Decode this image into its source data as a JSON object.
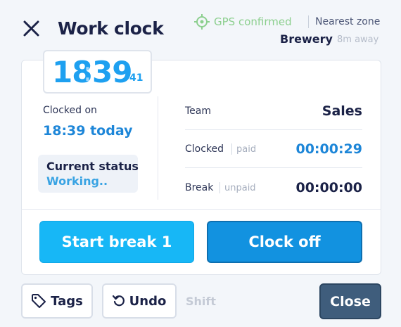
{
  "header": {
    "title": "Work clock",
    "gps_status": "GPS confirmed",
    "nearest_zone_label": "Nearest zone",
    "zone_name": "Brewery",
    "zone_distance": "8m away"
  },
  "clock": {
    "hours": "18",
    "separator": ":",
    "minutes": "39",
    "seconds": "41"
  },
  "clocked_on": {
    "label": "Clocked on",
    "value": "18:39 today"
  },
  "status": {
    "label": "Current status",
    "value": "Working.."
  },
  "summary": {
    "team_label": "Team",
    "team_value": "Sales",
    "clocked_label": "Clocked",
    "clocked_sub": "paid",
    "clocked_value": "00:00:29",
    "break_label": "Break",
    "break_sub": "unpaid",
    "break_value": "00:00:00"
  },
  "actions": {
    "start_break": "Start break 1",
    "clock_off": "Clock off"
  },
  "footer": {
    "tags": "Tags",
    "undo": "Undo",
    "shift": "Shift",
    "close": "Close"
  },
  "icons": {
    "close": "close-icon",
    "gps": "crosshair-icon",
    "tag": "tag-icon",
    "undo": "undo-icon"
  },
  "colors": {
    "primary_blue": "#1292e0",
    "light_blue": "#17b7f6",
    "clock_blue": "#1ea0f0",
    "gps_green": "#8ccf8e",
    "navy": "#1b2247",
    "close_btn": "#3f5d7c"
  }
}
